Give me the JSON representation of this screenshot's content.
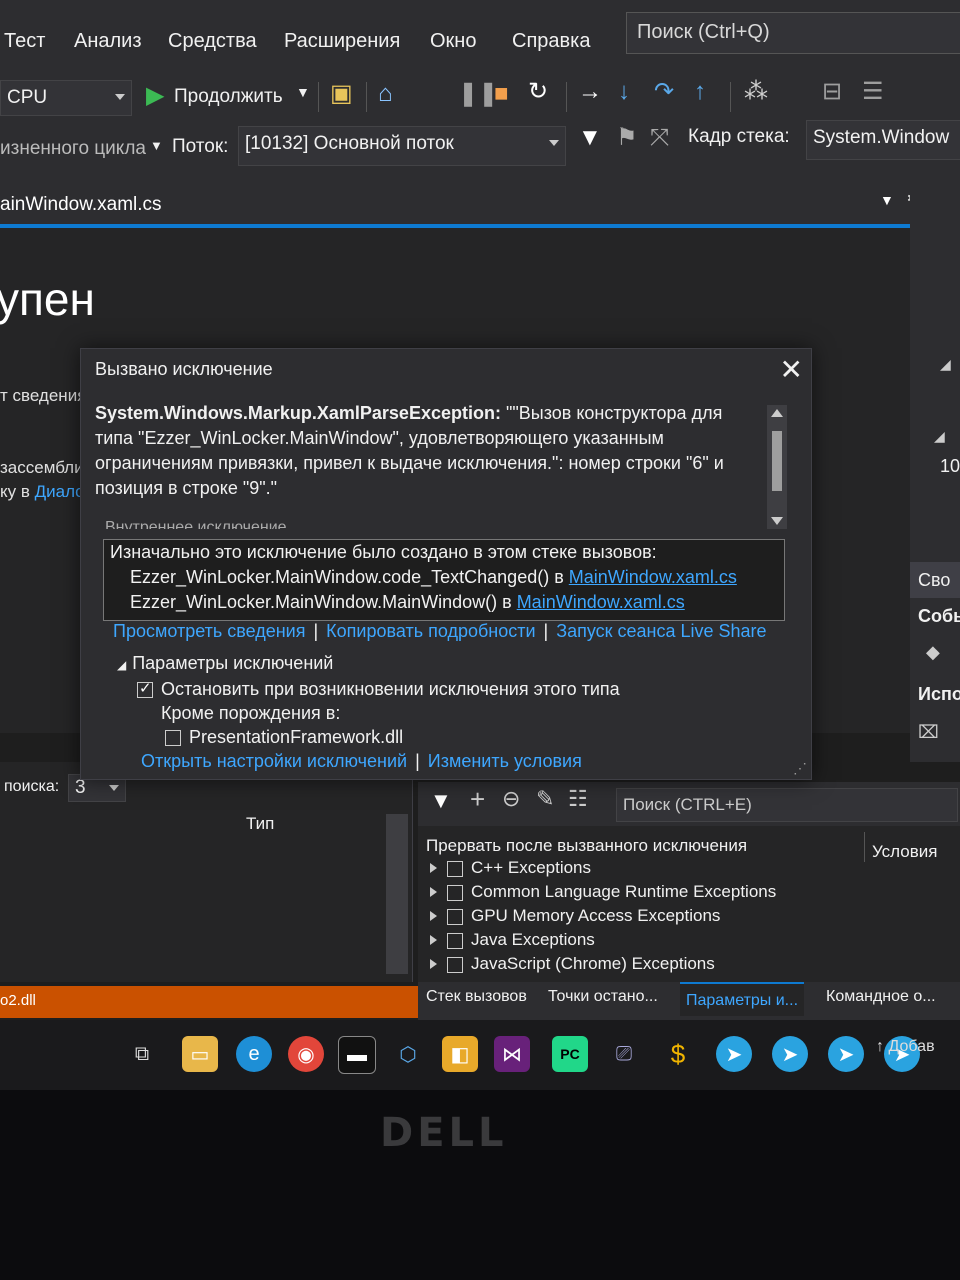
{
  "menu": {
    "items": [
      "Тест",
      "Анализ",
      "Средства",
      "Расширения",
      "Окно",
      "Справка"
    ],
    "search_placeholder": "Поиск (Ctrl+Q)"
  },
  "toolbar1": {
    "platform": "CPU",
    "continue_label": "Продолжить"
  },
  "toolbar2": {
    "lifecycle_label": "изненного цикла",
    "thread_label": "Поток:",
    "thread_value": "[10132] Основной поток",
    "stack_frame_label": "Кадр стека:",
    "stack_frame_value": "System.Window"
  },
  "tab": {
    "title": "ainWindow.xaml.cs"
  },
  "editor": {
    "heading": "упен",
    "line1": "т сведения",
    "line2": "зассембли",
    "line3_prefix": "ку в ",
    "line3_link": "Диалог"
  },
  "right_panel": {
    "number": "10",
    "buttons": [
      "Сво",
      "Собы",
      "Испо"
    ]
  },
  "dialog": {
    "title": "Вызвано исключение",
    "exception_type": "System.Windows.Markup.XamlParseException:",
    "message": "\"\"Вызов конструктора для типа \"Ezzer_WinLocker.MainWindow\", удовлетворяющего указанным ограничениям привязки, привел к выдаче исключения.\": номер строки \"6\" и позиция в строке \"9\".\"",
    "inner_label": "Внутреннее исключение",
    "stack_header": "Изначально это исключение было создано в этом стеке вызовов:",
    "stack": [
      {
        "frame": "Ezzer_WinLocker.MainWindow.code_TextChanged() в ",
        "file": "MainWindow.xaml.cs"
      },
      {
        "frame": "Ezzer_WinLocker.MainWindow.MainWindow() в ",
        "file": "MainWindow.xaml.cs"
      }
    ],
    "links": [
      "Просмотреть сведения",
      "Копировать подробности",
      "Запуск сеанса Live Share"
    ],
    "params_header": "Параметры исключений",
    "break_option": "Остановить при возникновении исключения этого типа",
    "except_label": "Кроме порождения в:",
    "except_item": "PresentationFramework.dll",
    "bottom_links": [
      "Открыть настройки исключений",
      "Изменить условия"
    ]
  },
  "bottom_left": {
    "search_depth_label": "поиска:",
    "search_depth_value": "3",
    "column_type": "Тип",
    "status_text": "o2.dll"
  },
  "exceptions_pane": {
    "search_placeholder": "Поиск (CTRL+E)",
    "column_break": "Прервать после вызванного исключения",
    "column_conditions": "Условия",
    "rows": [
      "C++ Exceptions",
      "Common Language Runtime Exceptions",
      "GPU Memory Access Exceptions",
      "Java Exceptions",
      "JavaScript (Chrome) Exceptions"
    ]
  },
  "bottom_tabs": [
    "Стек вызовов",
    "Точки остано...",
    "Параметры и...",
    "Командное о..."
  ],
  "taskbar": {
    "add_label": "Добав"
  },
  "bezel_logo": "DELL"
}
